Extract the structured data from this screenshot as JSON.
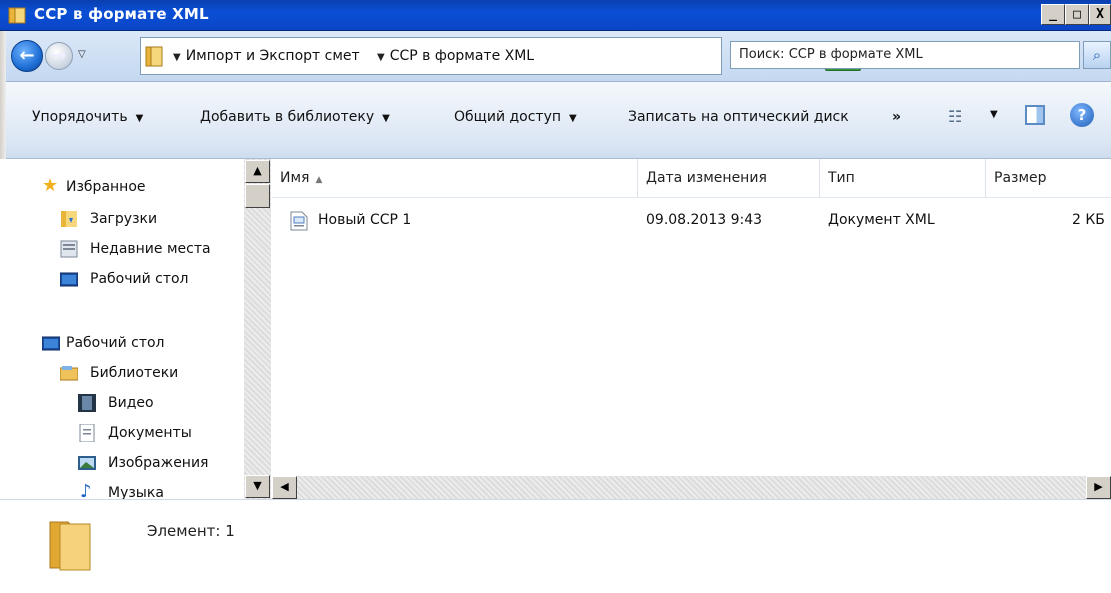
{
  "window": {
    "title": "ССР в формате XML",
    "buttons": {
      "minimize": "_",
      "maximize": "□",
      "close": "X"
    }
  },
  "address": {
    "crumbs": [
      "Импорт и Экспорт смет",
      "ССР в формате XML"
    ],
    "search_placeholder": "Поиск: ССР в формате XML"
  },
  "toolbar": {
    "organize": "Упорядочить",
    "add_to_library": "Добавить в библиотеку",
    "share": "Общий доступ",
    "burn": "Записать на оптический диск",
    "more": "»"
  },
  "nav": {
    "favorites": {
      "label": "Избранное",
      "items": [
        {
          "label": "Загрузки",
          "icon": "downloads-icon"
        },
        {
          "label": "Недавние места",
          "icon": "recent-places-icon"
        },
        {
          "label": "Рабочий стол",
          "icon": "desktop-icon"
        }
      ]
    },
    "tree": {
      "desktop": "Рабочий стол",
      "libraries": "Библиотеки",
      "items": [
        {
          "label": "Видео",
          "icon": "video-icon"
        },
        {
          "label": "Документы",
          "icon": "documents-icon"
        },
        {
          "label": "Изображения",
          "icon": "pictures-icon"
        },
        {
          "label": "Музыка",
          "icon": "music-icon"
        }
      ]
    }
  },
  "columns": {
    "name": "Имя",
    "date": "Дата изменения",
    "type": "Тип",
    "size": "Размер"
  },
  "files": [
    {
      "name": "Новый ССР 1",
      "date": "09.08.2013 9:43",
      "type": "Документ XML",
      "size": "2 КБ"
    }
  ],
  "details": {
    "status": "Элемент: 1"
  },
  "colors": {
    "titlebar": "#0a4fd6",
    "folder": "#f2c94c"
  }
}
